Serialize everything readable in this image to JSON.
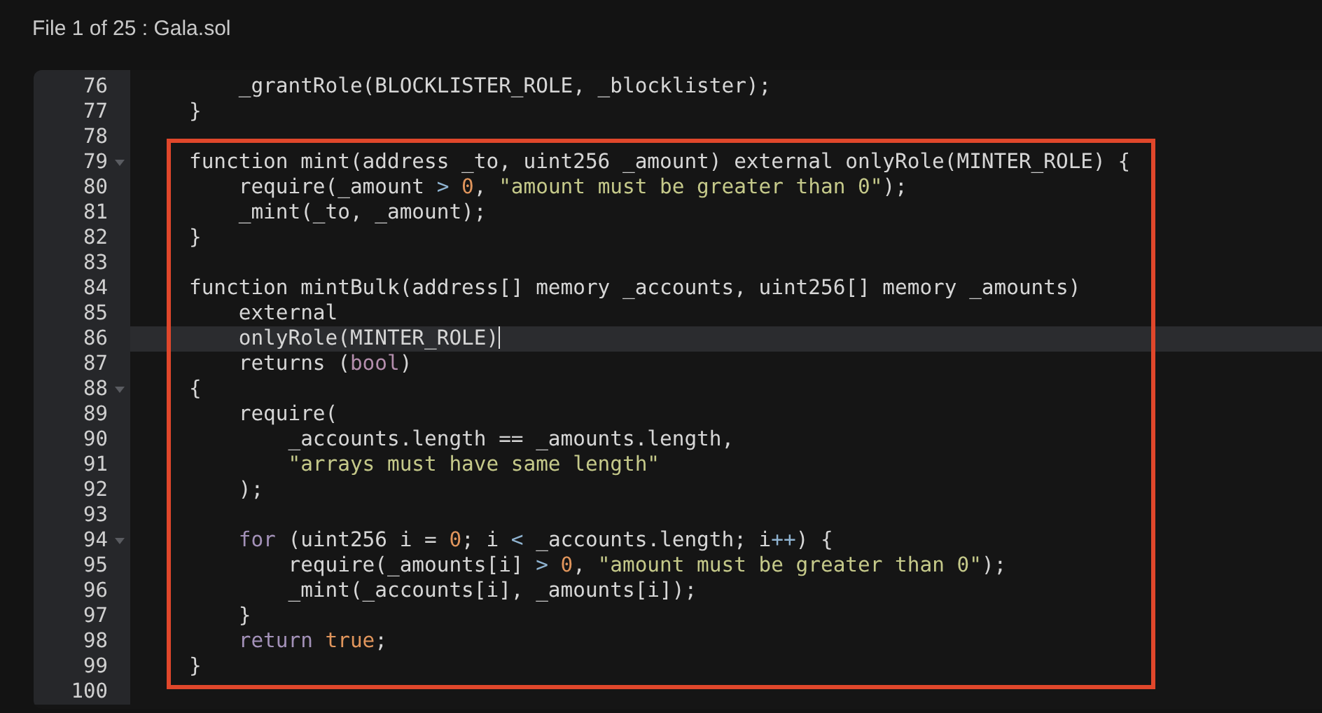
{
  "header": {
    "title": "File 1 of 25 : Gala.sol"
  },
  "editor": {
    "blocks": [
      {
        "framed": false,
        "lines": [
          {
            "number": "76",
            "fold": false,
            "active": false,
            "tokens": [
              {
                "kind": "plain",
                "text": "    _grantRole(BLOCKLISTER_ROLE, _blocklister);"
              }
            ]
          },
          {
            "number": "77",
            "fold": false,
            "active": false,
            "tokens": [
              {
                "kind": "plain",
                "text": "}"
              }
            ]
          },
          {
            "number": "78",
            "fold": false,
            "active": false
          }
        ]
      },
      {
        "framed": true,
        "lines": [
          {
            "number": "79",
            "fold": true,
            "active": false,
            "tokens": [
              {
                "kind": "plain",
                "text": "function mint(address _to, uint256 _amount) external onlyRole(MINTER_ROLE) {"
              }
            ]
          },
          {
            "number": "80",
            "fold": false,
            "active": false,
            "tokens": [
              {
                "kind": "plain",
                "text": "    require(_amount "
              },
              {
                "kind": "operator",
                "text": "> "
              },
              {
                "kind": "number",
                "text": "0"
              },
              {
                "kind": "plain",
                "text": ", "
              },
              {
                "kind": "string",
                "text": "\"amount must be greater than 0\""
              },
              {
                "kind": "plain",
                "text": ");"
              }
            ]
          },
          {
            "number": "81",
            "fold": false,
            "active": false,
            "tokens": [
              {
                "kind": "plain",
                "text": "    _mint(_to, _amount);"
              }
            ]
          },
          {
            "number": "82",
            "fold": false,
            "active": false,
            "tokens": [
              {
                "kind": "plain",
                "text": "}"
              }
            ]
          },
          {
            "number": "83",
            "fold": false,
            "active": false
          },
          {
            "number": "84",
            "fold": false,
            "active": false,
            "tokens": [
              {
                "kind": "plain",
                "text": "function mintBulk(address[] memory _accounts, uint256[] memory _amounts)"
              }
            ]
          },
          {
            "number": "85",
            "fold": false,
            "active": false,
            "tokens": [
              {
                "kind": "plain",
                "text": "    external"
              }
            ]
          },
          {
            "number": "86",
            "fold": false,
            "active": true,
            "tokens": [
              {
                "kind": "plain",
                "text": "    onlyRole(MINTER_ROLE)"
              }
            ]
          },
          {
            "number": "87",
            "fold": false,
            "active": false,
            "tokens": [
              {
                "kind": "plain",
                "text": "    returns ("
              },
              {
                "kind": "type",
                "text": "bool"
              },
              {
                "kind": "plain",
                "text": ")"
              }
            ]
          },
          {
            "number": "88",
            "fold": true,
            "active": false,
            "tokens": [
              {
                "kind": "plain",
                "text": "{"
              }
            ]
          },
          {
            "number": "89",
            "fold": false,
            "active": false,
            "tokens": [
              {
                "kind": "plain",
                "text": "    require("
              }
            ]
          },
          {
            "number": "90",
            "fold": false,
            "active": false,
            "tokens": [
              {
                "kind": "plain",
                "text": "        _accounts.length == _amounts.length,"
              }
            ]
          },
          {
            "number": "91",
            "fold": false,
            "active": false,
            "tokens": [
              {
                "kind": "string",
                "text": "        \"arrays must have same length\""
              }
            ]
          },
          {
            "number": "92",
            "fold": false,
            "active": false,
            "tokens": [
              {
                "kind": "plain",
                "text": "    );"
              }
            ]
          },
          {
            "number": "93",
            "fold": false,
            "active": false
          },
          {
            "number": "94",
            "fold": true,
            "active": false,
            "tokens": [
              {
                "kind": "keyword",
                "text": "    for"
              },
              {
                "kind": "plain",
                "text": " (uint256 i = "
              },
              {
                "kind": "number",
                "text": "0"
              },
              {
                "kind": "plain",
                "text": "; i "
              },
              {
                "kind": "operator",
                "text": "<"
              },
              {
                "kind": "plain",
                "text": " _accounts.length; i"
              },
              {
                "kind": "operator",
                "text": "++"
              },
              {
                "kind": "plain",
                "text": ") {"
              }
            ]
          },
          {
            "number": "95",
            "fold": false,
            "active": false,
            "tokens": [
              {
                "kind": "plain",
                "text": "        require(_amounts[i] "
              },
              {
                "kind": "operator",
                "text": "> "
              },
              {
                "kind": "number",
                "text": "0"
              },
              {
                "kind": "plain",
                "text": ", "
              },
              {
                "kind": "string",
                "text": "\"amount must be greater than 0\""
              },
              {
                "kind": "plain",
                "text": ");"
              }
            ]
          },
          {
            "number": "96",
            "fold": false,
            "active": false,
            "tokens": [
              {
                "kind": "plain",
                "text": "        _mint(_accounts[i], _amounts[i]);"
              }
            ]
          },
          {
            "number": "97",
            "fold": false,
            "active": false,
            "tokens": [
              {
                "kind": "plain",
                "text": "    }"
              }
            ]
          },
          {
            "number": "98",
            "fold": false,
            "active": false,
            "tokens": [
              {
                "kind": "keyword",
                "text": "    return "
              },
              {
                "kind": "number",
                "text": "true"
              },
              {
                "kind": "plain",
                "text": ";"
              }
            ]
          },
          {
            "number": "99",
            "fold": false,
            "active": false,
            "tokens": [
              {
                "kind": "plain",
                "text": "}"
              }
            ]
          }
        ]
      },
      {
        "framed": false,
        "lines": [
          {
            "number": "100",
            "fold": false,
            "active": false
          }
        ]
      }
    ]
  }
}
